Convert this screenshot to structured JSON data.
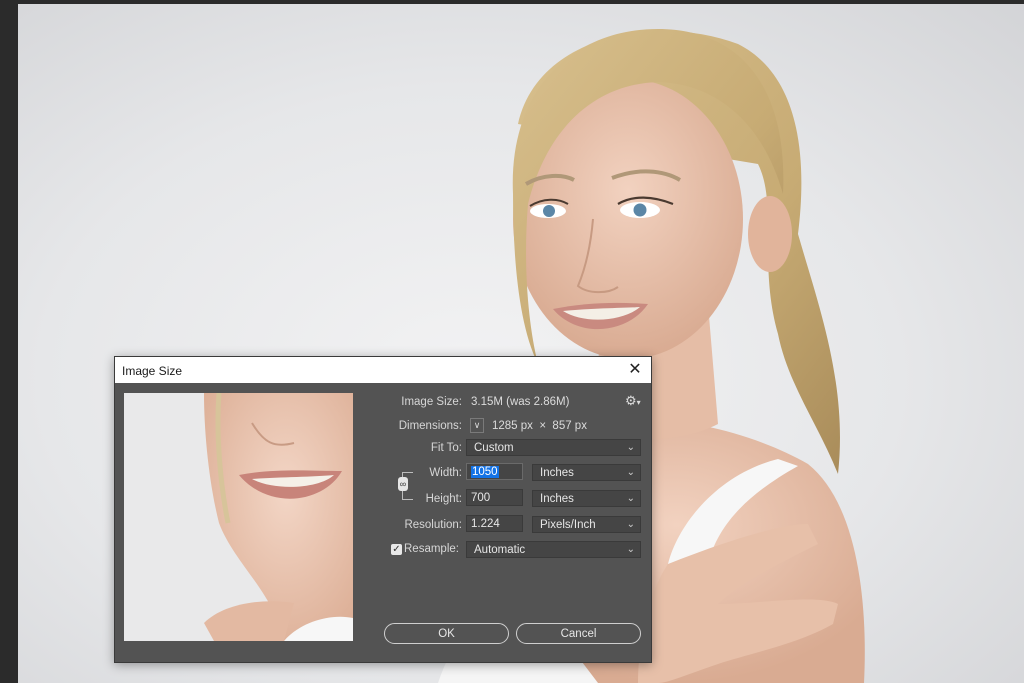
{
  "dialog": {
    "title": "Image Size",
    "close_icon": "close-icon",
    "image_size_label": "Image Size:",
    "image_size_value": "3.15M (was 2.86M)",
    "settings_icon": "gear-icon",
    "dimensions_label": "Dimensions:",
    "dimensions_value": "1285 px  ×  857 px",
    "fit_to_label": "Fit To:",
    "fit_to_value": "Custom",
    "width_label": "Width:",
    "width_value": "1050",
    "width_unit": "Inches",
    "height_label": "Height:",
    "height_value": "700",
    "height_unit": "Inches",
    "resolution_label": "Resolution:",
    "resolution_value": "1.224",
    "resolution_unit": "Pixels/Inch",
    "resample_label": "Resample:",
    "resample_checked": true,
    "resample_value": "Automatic",
    "ok_label": "OK",
    "cancel_label": "Cancel"
  },
  "colors": {
    "dialog_bg": "#535353",
    "field_bg": "#454545",
    "selection": "#1473e6",
    "titlebar_bg": "#ffffff"
  }
}
